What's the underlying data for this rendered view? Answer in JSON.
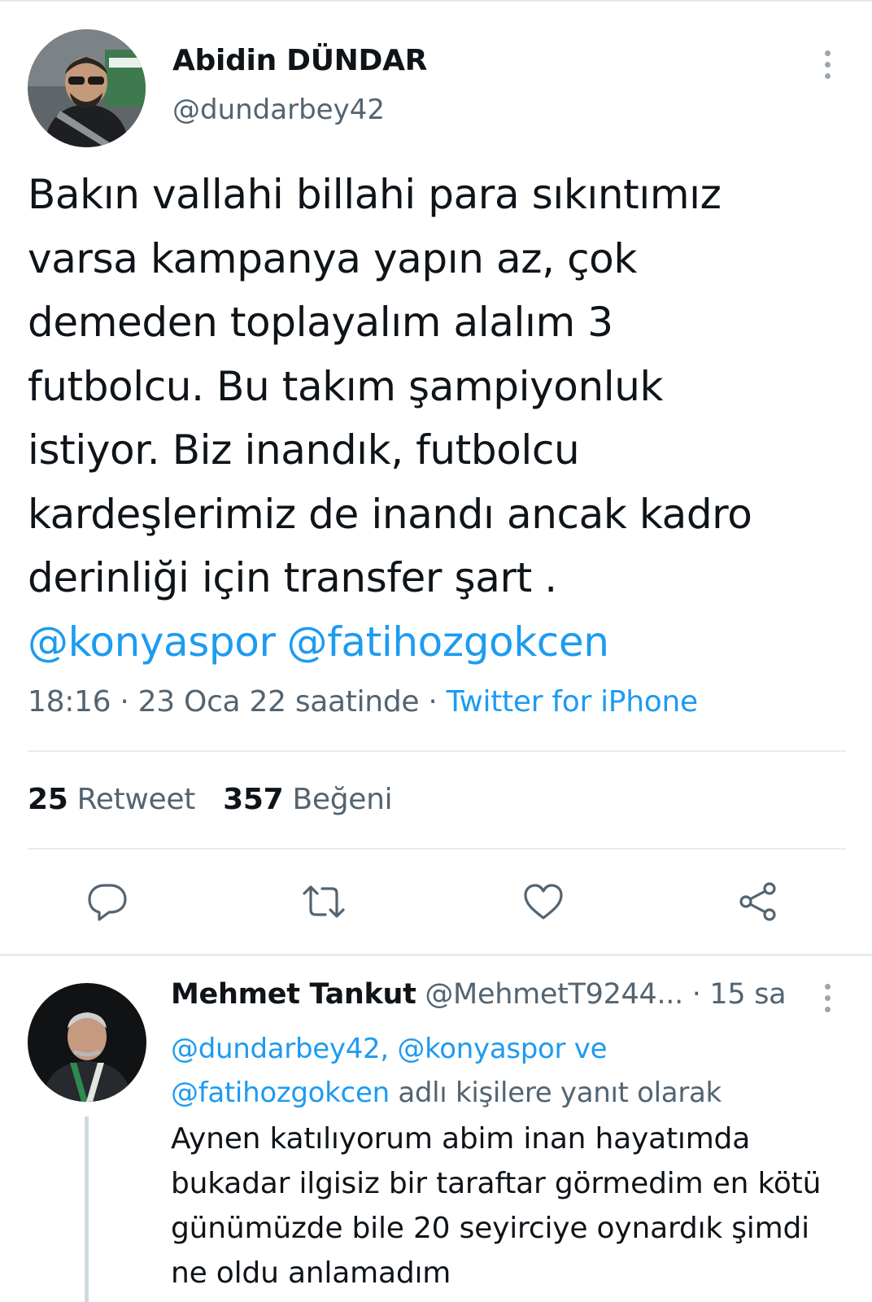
{
  "author": {
    "name": "Abidin DÜNDAR",
    "handle": "@dundarbey42"
  },
  "tweet": {
    "lines": [
      "Bakın vallahi billahi para sıkıntımız",
      "varsa kampanya yapın az, çok",
      "demeden toplayalım alalım 3",
      "futbolcu. Bu takım şampiyonluk",
      "istiyor. Biz inandık, futbolcu",
      "kardeşlerimiz de inandı ancak kadro",
      "derinliği için transfer şart ."
    ],
    "mentions": [
      "@konyaspor",
      "@fatihozgokcen"
    ],
    "time": "18:16 · 23 Oca 22 saatinde · ",
    "source": "Twitter for iPhone"
  },
  "stats": {
    "retweets": "25",
    "retweets_label": "Retweet",
    "likes": "357",
    "likes_label": "Beğeni"
  },
  "actions": {
    "icons": [
      "reply-icon",
      "retweet-icon",
      "like-icon",
      "share-icon"
    ]
  },
  "reply": {
    "name": "Mehmet Tankut",
    "handle": "@MehmetT9244...",
    "time": " · 15 sa",
    "replying_mentions_1": "@dundarbey42, @konyaspor",
    "replying_ve": " ve",
    "replying_mentions_2": "@fatihozgokcen",
    "replying_suffix": " adlı kişilere yanıt olarak",
    "lines": [
      "Aynen katılıyorum abim inan hayatımda",
      "bukadar ilgisiz bir taraftar görmedim en kötü",
      "günümüzde bile 20 seyirciye oynardık şimdi",
      "ne oldu anlamadım"
    ]
  },
  "colors": {
    "link": "#1d9bf0",
    "secondary_text": "#536471",
    "primary_text": "#0f1419",
    "divider": "#e6ecf0"
  }
}
